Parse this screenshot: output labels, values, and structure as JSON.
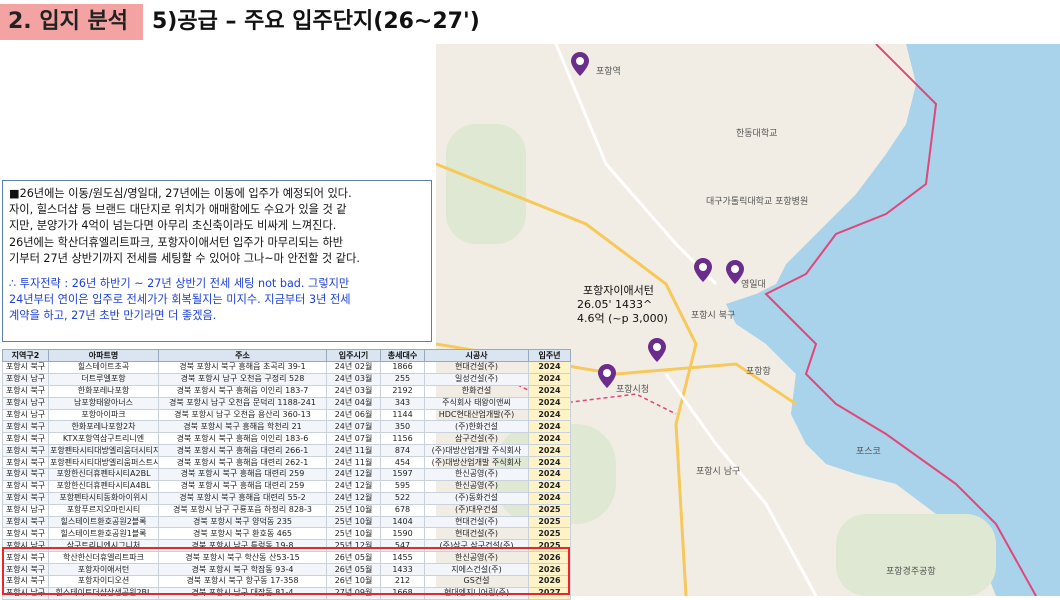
{
  "header": {
    "section_tag": "2. 입지 분석",
    "title": "5)공급 – 주요 입주단지(26~27')"
  },
  "note": {
    "lines": [
      "■26년에는 이동/원도심/영일대, 27년에는 이동에 입주가 예정되어 있다.",
      "자이, 힐스더샵 등 브랜드 대단지로 위치가 애매함에도 수요가 있을 것 같",
      "지만, 분양가가 4억이 넘는다면 아무리 초신축이라도 비싸게 느껴진다.",
      " 26년에는 학산더휴엘리트파크, 포항자이애서턴 입주가 마무리되는 하반",
      "기부터 27년 상반기까지 전세를 세팅할 수 있어야 그나~마 안전할 것 같다."
    ],
    "strategy_lines": [
      "∴ 투자전략 : 26년 하반기 ~ 27년 상반기 전세 세팅 not bad. 그렇지만",
      "24년부터 연이은 입주로 전세가가 회복될지는 미지수. 지금부터 3년 전세",
      "계약을 하고, 27년 초반 만기라면 더 좋겠음."
    ]
  },
  "table": {
    "headers": [
      "지역구2",
      "아파트명",
      "주소",
      "입주시기",
      "총세대수",
      "시공사",
      "입주년"
    ],
    "rows": [
      [
        "포항시 북구",
        "힐스테이트초곡",
        "경북 포항시 북구 흥해읍 초곡리 39-1",
        "24년 02월",
        "1866",
        "현대건설(주)",
        "2024"
      ],
      [
        "포항시 남구",
        "더트루엘포항",
        "경북 포항시 남구 오천읍 구정리 528",
        "24년 03월",
        "255",
        "일성건설(주)",
        "2024"
      ],
      [
        "포항시 북구",
        "한화포레나포항",
        "경북 포항시 북구 흥해읍 이인리 183-7",
        "24년 03월",
        "2192",
        "한화건설",
        "2024"
      ],
      [
        "포항시 남구",
        "남포항태왕아너스",
        "경북 포항시 남구 오천읍 문덕리 1188-241",
        "24년 04월",
        "343",
        "주식회사 태왕이앤씨",
        "2024"
      ],
      [
        "포항시 남구",
        "포항아이파크",
        "경북 포항시 남구 오천읍 용산리 360-13",
        "24년 06월",
        "1144",
        "HDC현대산업개발(주)",
        "2024"
      ],
      [
        "포항시 북구",
        "한화포레나포항2차",
        "경북 포항시 북구 흥해읍 학천리 21",
        "24년 07월",
        "350",
        "(주)한화건설",
        "2024"
      ],
      [
        "포항시 북구",
        "KTX포항역삼구트리니엔",
        "경북 포항시 북구 흥해읍 이인리 183-6",
        "24년 07월",
        "1156",
        "삼구건설(주)",
        "2024"
      ],
      [
        "포항시 북구",
        "포항펜타시티대방엘리움더시티지차",
        "경북 포항시 북구 흥해읍 대련리 266-1",
        "24년 11월",
        "874",
        "(주)대방산업개발 주식회사",
        "2024"
      ],
      [
        "포항시 북구",
        "포항펜타시티대방엘리움퍼스트시티2차",
        "경북 포항시 북구 흥해읍 대련리 262-1",
        "24년 11월",
        "454",
        "(주)대방산업개발 주식회사",
        "2024"
      ],
      [
        "포항시 북구",
        "포항한신더휴펜타시티A2BL",
        "경북 포항시 북구 흥해읍 대련리 259",
        "24년 12월",
        "1597",
        "한신공영(주)",
        "2024"
      ],
      [
        "포항시 북구",
        "포항한신더휴펜타시티A4BL",
        "경북 포항시 북구 흥해읍 대련리 259",
        "24년 12월",
        "595",
        "한신공영(주)",
        "2024"
      ],
      [
        "포항시 북구",
        "포항펜타시티동화아이위시",
        "경북 포항시 북구 흥해읍 대련리 55-2",
        "24년 12월",
        "522",
        "(주)동화건설",
        "2024"
      ],
      [
        "포항시 남구",
        "포항푸르지오마린시티",
        "경북 포항시 남구 구룡포읍 하정리 828-3",
        "25년 10월",
        "678",
        "(주)대우건설",
        "2025"
      ],
      [
        "포항시 북구",
        "힐스테이트환호공원2블록",
        "경북 포항시 북구 양덕동 235",
        "25년 10월",
        "1404",
        "현대건설(주)",
        "2025"
      ],
      [
        "포항시 북구",
        "힐스테이트환호공원1블록",
        "경북 포항시 북구 환호동 465",
        "25년 10월",
        "1590",
        "현대건설(주)",
        "2025"
      ],
      [
        "포항시 남구",
        "삼구트리니엔시그니처",
        "경북 포항시 남구 특렁동 19-8",
        "25년 12월",
        "547",
        "(주)삼구,삼구건설(주)",
        "2025"
      ],
      [
        "포항시 북구",
        "학산한신더휴엘리트파크",
        "경북 포항시 북구 학산동 산53-15",
        "26년 05월",
        "1455",
        "한신공영(주)",
        "2026"
      ],
      [
        "포항시 북구",
        "포항자이애서턴",
        "경북 포항시 북구 학잠동 93-4",
        "26년 05월",
        "1433",
        "지에스건설(주)",
        "2026"
      ],
      [
        "포항시 북구",
        "포항자이디오션",
        "경북 포항시 북구 항구동 17-358",
        "26년 10월",
        "212",
        "GS건설",
        "2026"
      ],
      [
        "포항시 남구",
        "힐스테이트더샵상생공원2BL",
        "경북 포항시 남구 대잠동 81-4",
        "27년 09월",
        "1668",
        "현대엔지니어링(주)",
        "2027"
      ]
    ]
  },
  "map": {
    "callout_name": "포항자이애서턴",
    "callout_price": "26.05' 1433^",
    "callout_detail": "4.6억 (~p 3,000)",
    "labels": {
      "handong": "한동대학교",
      "daegu_hospital": "대구가톨릭대학교 포항병원",
      "yeongildae": "영일대",
      "pohang_city": "포항시청",
      "pohang_station": "포항역",
      "pohang_port": "포항항",
      "bukgu": "포항시 북구",
      "namgu": "포항시 남구",
      "pohang_airport": "포항경주공항",
      "posco": "포스코"
    },
    "colors": {
      "sea": "#a9d3ea",
      "land": "#f1ede4",
      "boundary": "#e2457a",
      "pin": "#6b2d8c"
    }
  }
}
